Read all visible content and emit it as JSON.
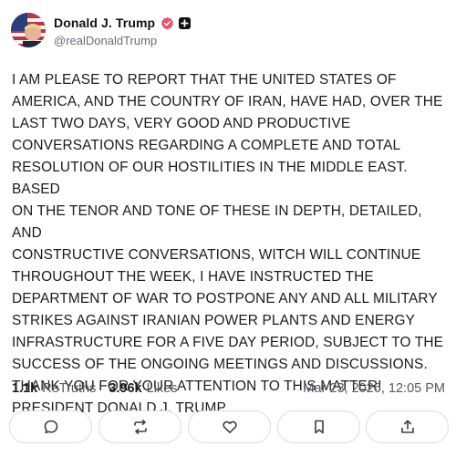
{
  "author": {
    "display_name": "Donald J. Trump",
    "handle": "@realDonaldTrump",
    "verified_icon": "verified-badge-icon",
    "plus_icon": "plus-badge-icon"
  },
  "post": {
    "body": "I AM PLEASE TO REPORT THAT THE UNITED STATES OF\nAMERICA, AND THE COUNTRY OF IRAN, HAVE HAD, OVER THE\nLAST TWO DAYS, VERY GOOD AND PRODUCTIVE\nCONVERSATIONS REGARDING A COMPLETE AND TOTAL\nRESOLUTION OF OUR HOSTILITIES IN THE MIDDLE EAST. BASED\nON THE TENOR AND TONE OF THESE IN DEPTH, DETAILED, AND\nCONSTRUCTIVE CONVERSATIONS, WITCH WILL CONTINUE\nTHROUGHOUT THE WEEK, I HAVE INSTRUCTED THE\nDEPARTMENT OF WAR TO POSTPONE ANY AND ALL MILITARY\nSTRIKES AGAINST IRANIAN POWER PLANTS AND ENERGY\nINFRASTRUCTURE FOR A FIVE DAY PERIOD, SUBJECT TO THE\nSUCCESS OF THE ONGOING MEETINGS AND DISCUSSIONS.\nTHANK YOU FOR YOUR ATTENTION TO THIS MATTER!\nPRESIDENT DONALD J. TRUMP"
  },
  "stats": {
    "retruths_count": "1.1k",
    "retruths_label": "ReTruths",
    "likes_count": "3.96k",
    "likes_label": "Likes",
    "timestamp": "Mar 23, 2026, 12:05 PM"
  },
  "actions": [
    {
      "icon": "reply-icon"
    },
    {
      "icon": "retruth-icon"
    },
    {
      "icon": "like-icon"
    },
    {
      "icon": "bookmark-icon"
    },
    {
      "icon": "share-icon"
    }
  ],
  "colors": {
    "verified": "#e0566b",
    "text": "#1b1b1f",
    "muted": "#555863",
    "border": "#dcdde3"
  }
}
